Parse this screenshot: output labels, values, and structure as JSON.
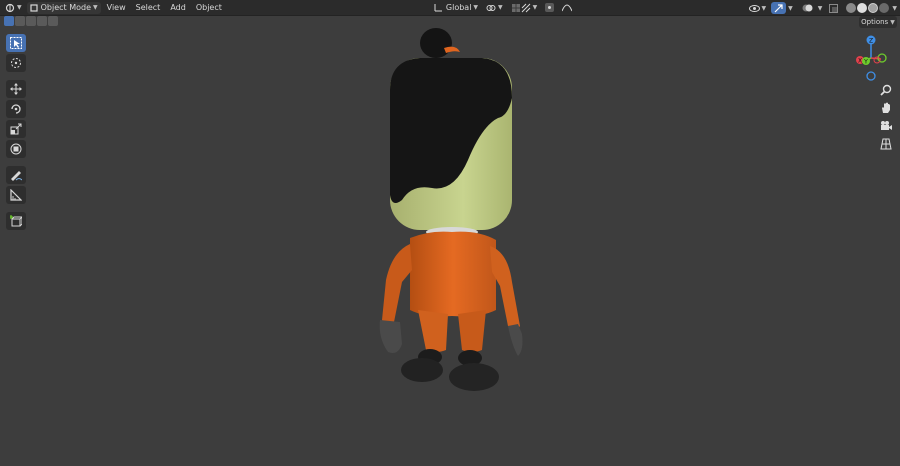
{
  "header": {
    "mode": "Object Mode",
    "menus": [
      "View",
      "Select",
      "Add",
      "Object"
    ],
    "orientation": "Global"
  },
  "options_label": "Options",
  "gizmo": {
    "x": "X",
    "y": "Y",
    "z": "Z"
  },
  "colors": {
    "accent": "#4772b3",
    "viewport_bg": "#3d3d3d",
    "header_bg": "#2b2b2b",
    "axis_x": "#e2414c",
    "axis_y": "#6ecc2c",
    "axis_z": "#3f8fe6",
    "character_shirt": "#e0651f",
    "character_head": "#c3d08d",
    "character_hair": "#151515"
  }
}
